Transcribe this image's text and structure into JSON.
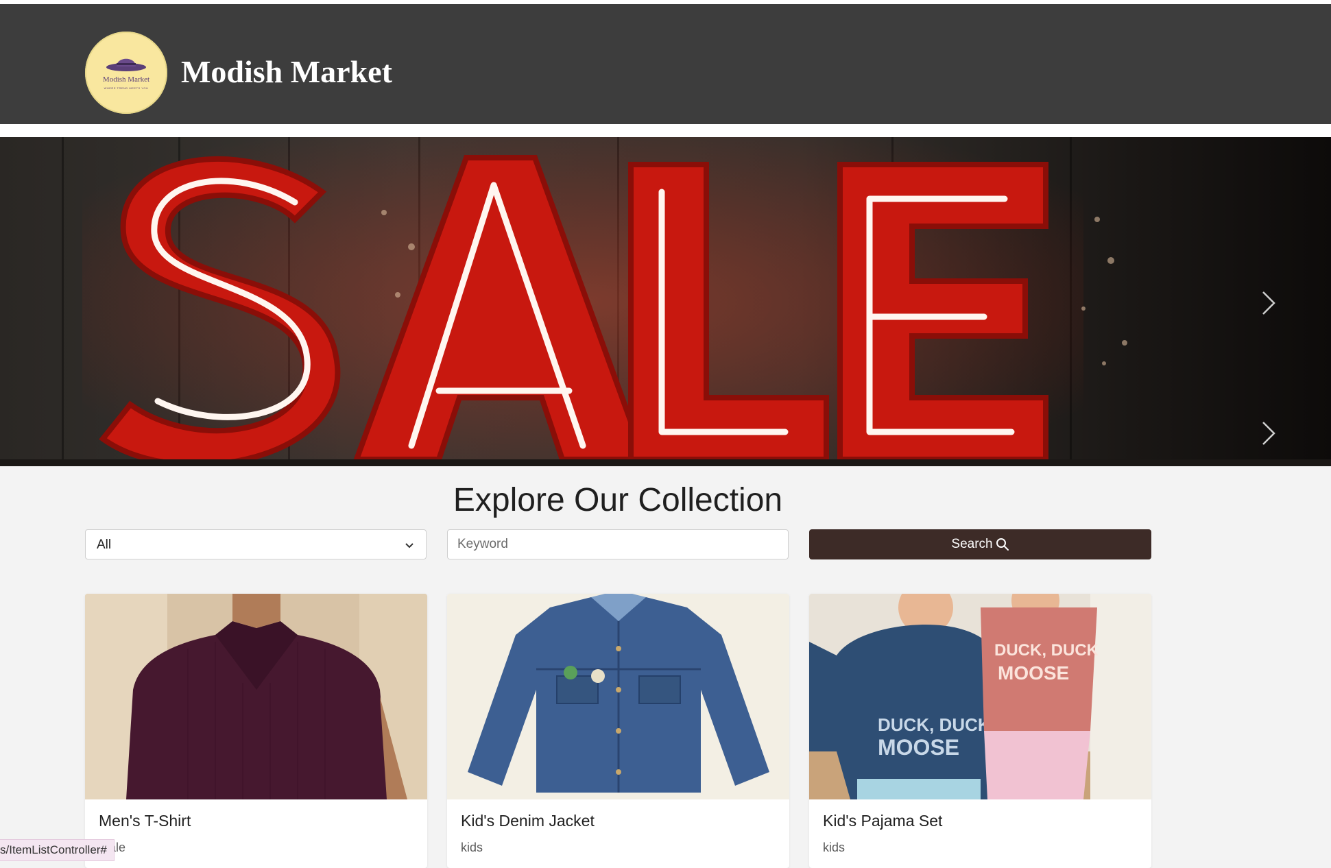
{
  "header": {
    "brand_name": "Modish Market",
    "logo_text": "Modish Market",
    "logo_tagline": "WHERE TREND MEETS YOU",
    "logo_icon": "hat-icon"
  },
  "hero": {
    "text": "SALE",
    "next_icon": "chevron-right-icon"
  },
  "collection": {
    "title": "Explore Our Collection",
    "category_select": {
      "value": "All"
    },
    "keyword_input": {
      "placeholder": "Keyword",
      "value": ""
    },
    "search_button": {
      "label": "Search",
      "icon": "search-icon"
    }
  },
  "products": [
    {
      "name": "Men's T-Shirt",
      "category": "male"
    },
    {
      "name": "Kid's Denim Jacket",
      "category": "kids"
    },
    {
      "name": "Kid's Pajama Set",
      "category": "kids"
    }
  ],
  "status_bar": {
    "url": "s/ItemListController#"
  },
  "colors": {
    "header_bg": "#3d3d3d",
    "logo_bg": "#f9e79f",
    "button_bg": "#3d2b27",
    "sale_red": "#c8180f"
  }
}
